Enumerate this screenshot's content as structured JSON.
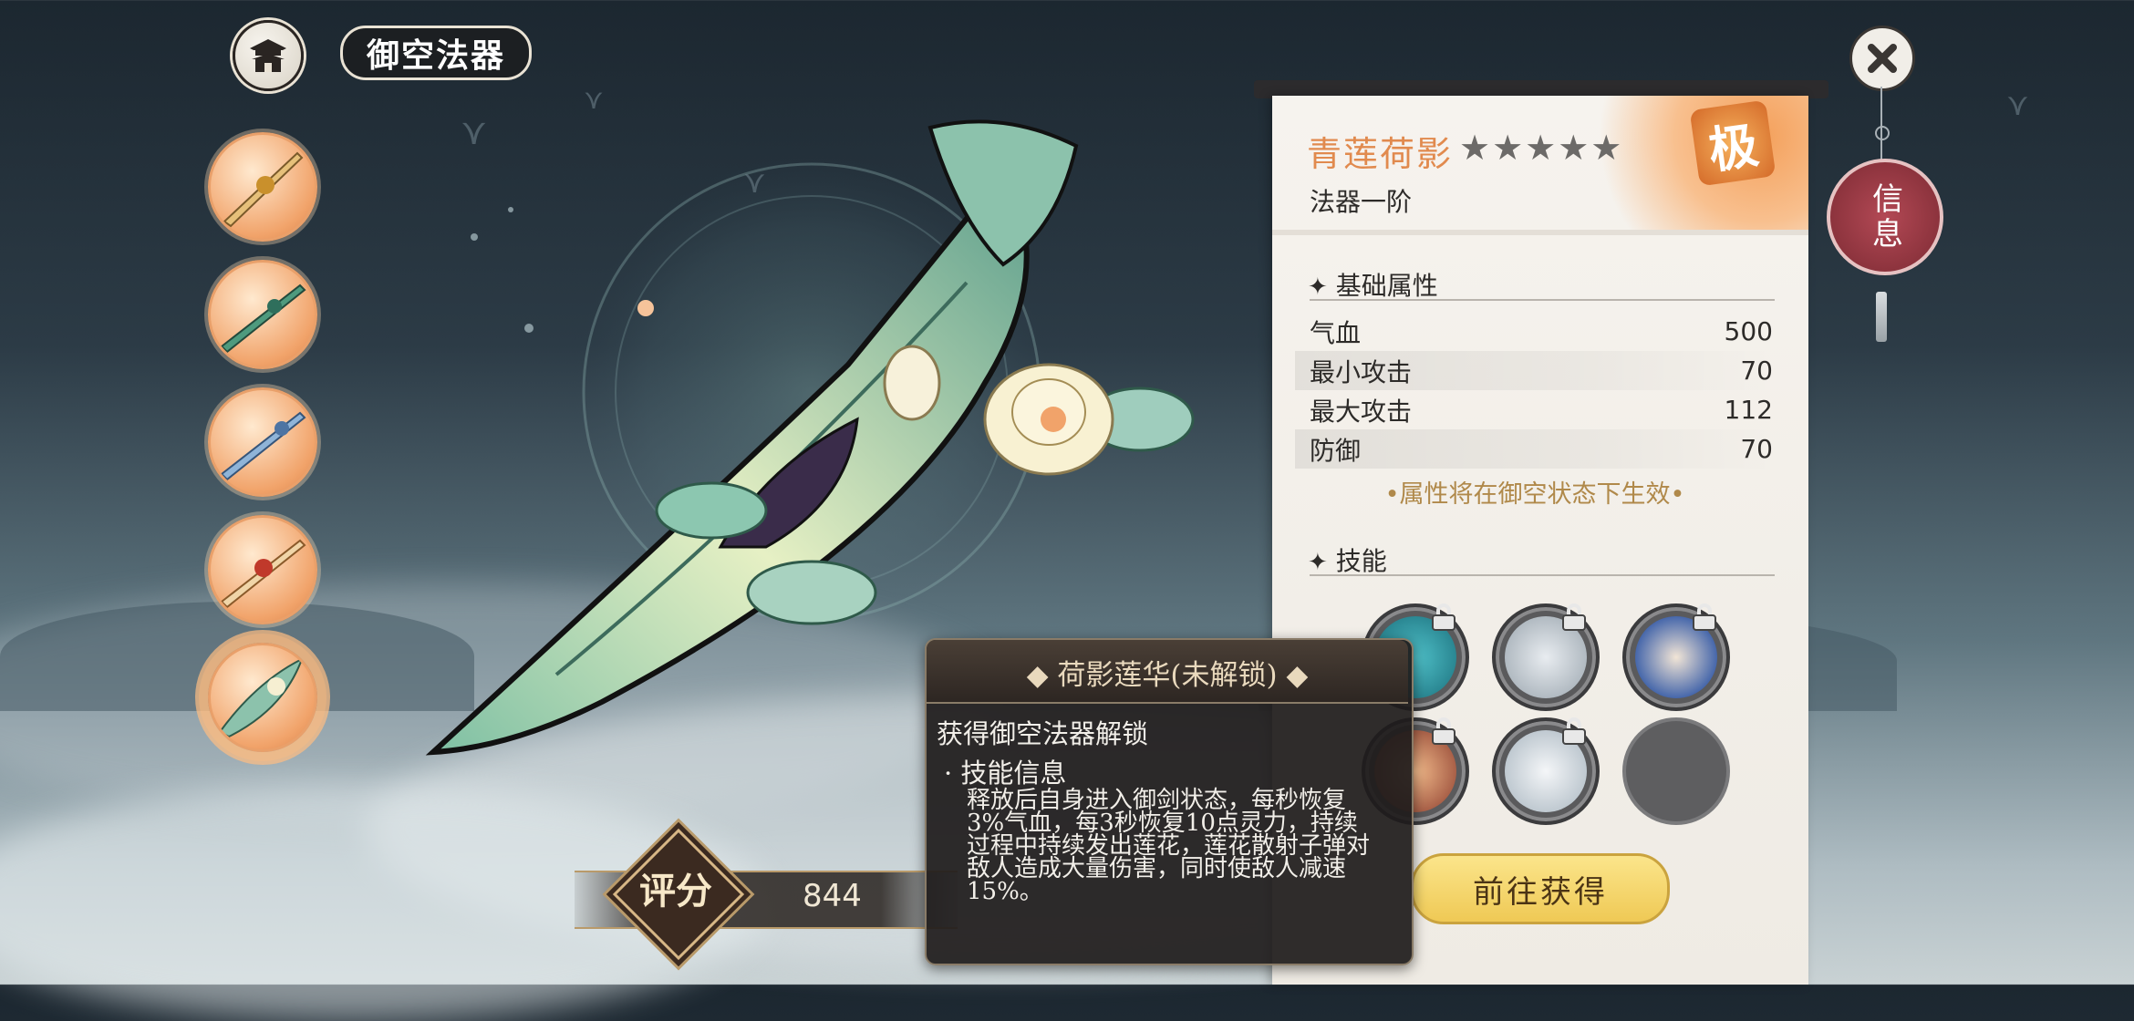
{
  "header": {
    "title": "御空法器",
    "home_icon": "pavilion-icon",
    "close_icon": "close-icon"
  },
  "weapon_list": [
    {
      "name": "golden-sword",
      "selected": false
    },
    {
      "name": "jade-sword",
      "selected": false
    },
    {
      "name": "azure-sword",
      "selected": false
    },
    {
      "name": "crimson-sword",
      "selected": false
    },
    {
      "name": "lotus-leaf",
      "selected": true
    }
  ],
  "score": {
    "label": "评分",
    "value": "844"
  },
  "item": {
    "name": "青莲荷影",
    "stars": 5,
    "stars_text": "★★★★★",
    "tier": "法器一阶",
    "rank_seal": "极",
    "name_color": "#e18a4e"
  },
  "base_stats": {
    "heading": "基础属性",
    "rows": [
      {
        "label": "气血",
        "value": "500"
      },
      {
        "label": "最小攻击",
        "value": "70"
      },
      {
        "label": "最大攻击",
        "value": "112"
      },
      {
        "label": "防御",
        "value": "70"
      }
    ],
    "note": "•属性将在御空状态下生效•"
  },
  "skills": {
    "heading": "技能",
    "icons": [
      {
        "name": "skill-lotus-icon",
        "locked": true
      },
      {
        "name": "skill-sword-wing-icon",
        "locked": true
      },
      {
        "name": "skill-swirl-hero-icon",
        "locked": true
      },
      {
        "name": "skill-spin-icon",
        "locked": true
      },
      {
        "name": "skill-dash-hero-icon",
        "locked": true
      },
      {
        "name": "skill-empty-slot",
        "locked": false
      }
    ]
  },
  "obtain_button": "前往获得",
  "side_tab": "信息",
  "tooltip": {
    "title": "◆ 荷影莲华(未解锁) ◆",
    "condition": "获得御空法器解锁",
    "bullet": "· 技能信息",
    "description": "释放后自身进入御剑状态，每秒恢复3%气血，每3秒恢复10点灵力，持续过程中持续发出莲花，莲花散射子弹对敌人造成大量伤害，同时使敌人减速15%。"
  }
}
